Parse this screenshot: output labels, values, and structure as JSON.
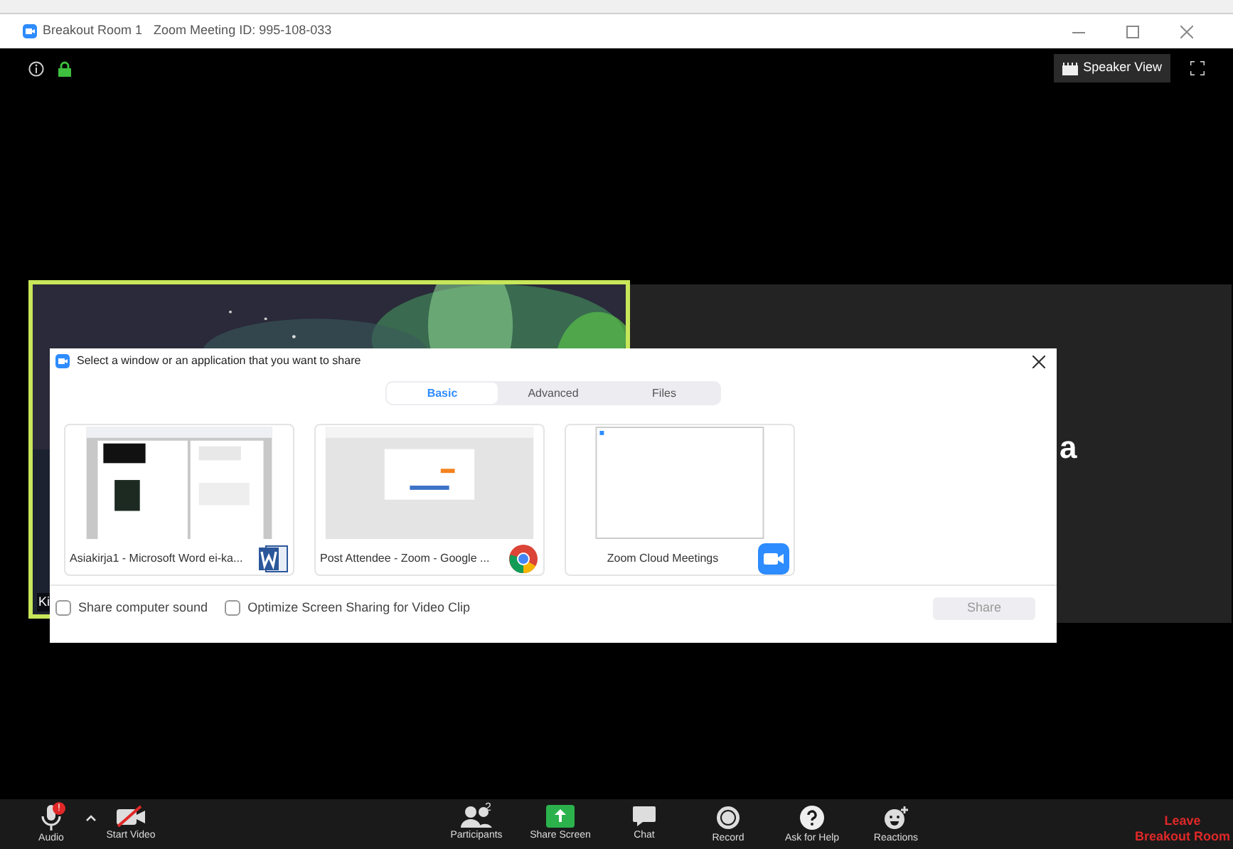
{
  "window": {
    "title": "Breakout Room 1",
    "meeting_id": "Zoom Meeting ID: 995-108-033"
  },
  "top_bar": {
    "view_button": "Speaker View"
  },
  "tiles": [
    {
      "kind": "picture",
      "name": "Ki",
      "active": true
    },
    {
      "kind": "name",
      "name": "a",
      "active": false
    }
  ],
  "dialog": {
    "title": "Select a window or an application that you want to share",
    "tabs": [
      {
        "label": "Basic",
        "selected": true
      },
      {
        "label": "Advanced",
        "selected": false
      },
      {
        "label": "Files",
        "selected": false
      }
    ],
    "windows": [
      {
        "label": "Asiakirja1 - Microsoft Word ei-ka...",
        "kind": "word"
      },
      {
        "label": "Post Attendee - Zoom - Google ...",
        "kind": "chrome"
      },
      {
        "label": "Zoom Cloud Meetings",
        "kind": "zoom"
      }
    ],
    "options": [
      {
        "label": "Share computer sound",
        "checked": false
      },
      {
        "label": "Optimize Screen Sharing for Video Clip",
        "checked": false
      }
    ],
    "share_button": {
      "label": "Share",
      "disabled": true
    }
  },
  "toolbar": {
    "left": [
      {
        "kind": "audio",
        "label": "Audio",
        "badge": "!"
      },
      {
        "kind": "video",
        "label": "Start Video"
      }
    ],
    "center": [
      {
        "kind": "participants",
        "label": "Participants",
        "count": "2"
      },
      {
        "kind": "share",
        "label": "Share Screen"
      },
      {
        "kind": "chat",
        "label": "Chat"
      },
      {
        "kind": "record",
        "label": "Record"
      },
      {
        "kind": "help",
        "label": "Ask for Help"
      },
      {
        "kind": "reactions",
        "label": "Reactions"
      }
    ],
    "leave": [
      "Leave",
      "Breakout Room"
    ]
  }
}
